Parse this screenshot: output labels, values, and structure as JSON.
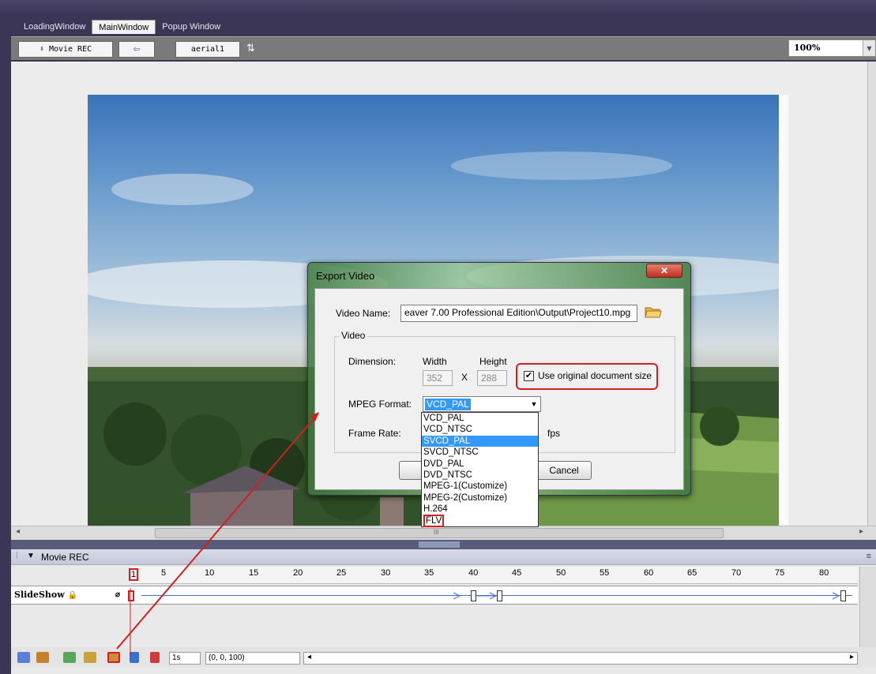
{
  "tabs": [
    {
      "label": "LoadingWindow"
    },
    {
      "label": "MainWindow"
    },
    {
      "label": "Popup Window"
    }
  ],
  "toolbar": {
    "movie_rec": "Movie REC",
    "back_arrow": "⇦",
    "layer_select": "aerial1",
    "sort_icon": "⇅"
  },
  "zoom": {
    "value": "100%"
  },
  "dialog": {
    "title": "Export Video",
    "close_glyph": "✕",
    "video_name_label": "Video Name:",
    "video_name_value": "eaver 7.00 Professional Edition\\Output\\Project10.mpg",
    "group_label": "Video",
    "dimension_label": "Dimension:",
    "width_label": "Width",
    "height_label": "Height",
    "width_value": "352",
    "height_value": "288",
    "x_label": "X",
    "use_original_label": "Use original document size",
    "use_original_checked": "✔",
    "mpeg_format_label": "MPEG Format:",
    "mpeg_format_value": "VCD_PAL",
    "frame_rate_label": "Frame Rate:",
    "fps_label": "fps",
    "cancel_label": "Cancel"
  },
  "mpeg_options": [
    "VCD_PAL",
    "VCD_NTSC",
    "SVCD_PAL",
    "SVCD_NTSC",
    "DVD_PAL",
    "DVD_NTSC",
    "MPEG-1(Customize)",
    "MPEG-2(Customize)",
    "H.264",
    "FLV"
  ],
  "highlighted_option": "SVCD_PAL",
  "timeline": {
    "title": "Movie REC",
    "layer_name": "SlideShow",
    "ruler_ticks": [
      "1",
      "5",
      "10",
      "15",
      "20",
      "25",
      "30",
      "35",
      "40",
      "45",
      "50",
      "55",
      "60",
      "65",
      "70",
      "75",
      "80"
    ],
    "frame_value": "1s",
    "coords_value": "(0, 0, 100)",
    "scroll_thumb": "III"
  },
  "colors": {
    "annotation_red": "#d21f1f",
    "selection_blue": "#3399ff",
    "track_blue": "#4a6bd0"
  }
}
